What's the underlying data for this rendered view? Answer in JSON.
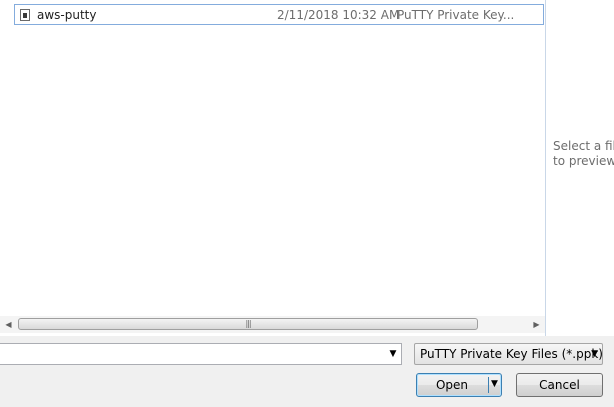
{
  "file_list": {
    "rows": [
      {
        "name": "aws-putty",
        "date": "2/11/2018 10:32 AM",
        "type": "PuTTY Private Key..."
      }
    ],
    "icon": "file-icon"
  },
  "scrollbar": {
    "left_arrow": "◀",
    "right_arrow": "▶",
    "grip": "|||"
  },
  "preview": {
    "text": "Select a file\nto preview."
  },
  "filename": {
    "value": "",
    "dropdown_arrow": "▼"
  },
  "filter": {
    "selected": "PuTTY Private Key Files (*.ppk)",
    "arrow": "▼"
  },
  "buttons": {
    "open_label": "Open",
    "open_arrow": "▼",
    "cancel_label": "Cancel"
  }
}
